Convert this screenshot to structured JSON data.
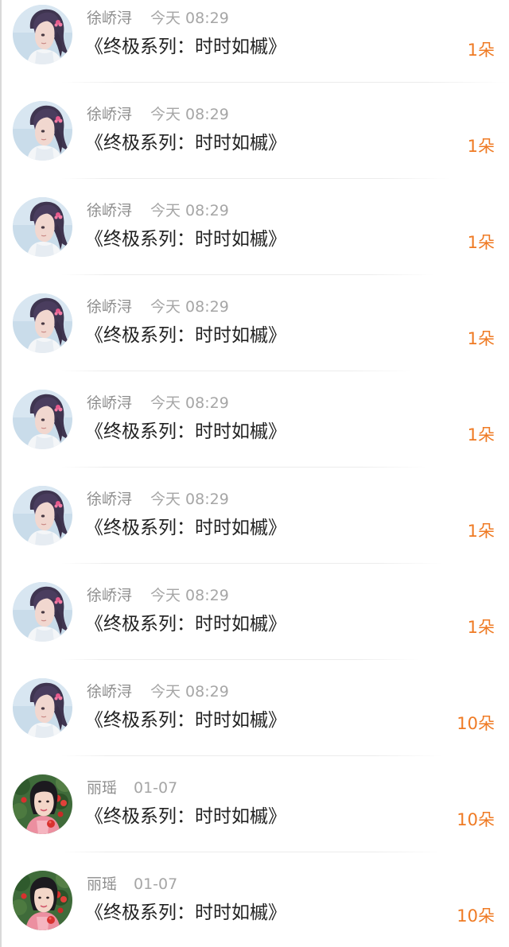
{
  "records": [
    {
      "name": "徐峤浔",
      "time": "今天 08:29",
      "title": "《终极系列：时时如槭》",
      "count": "1朵",
      "avatar": "girl-purple-hair-avatar"
    },
    {
      "name": "徐峤浔",
      "time": "今天 08:29",
      "title": "《终极系列：时时如槭》",
      "count": "1朵",
      "avatar": "girl-purple-hair-avatar"
    },
    {
      "name": "徐峤浔",
      "time": "今天 08:29",
      "title": "《终极系列：时时如槭》",
      "count": "1朵",
      "avatar": "girl-purple-hair-avatar"
    },
    {
      "name": "徐峤浔",
      "time": "今天 08:29",
      "title": "《终极系列：时时如槭》",
      "count": "1朵",
      "avatar": "girl-purple-hair-avatar"
    },
    {
      "name": "徐峤浔",
      "time": "今天 08:29",
      "title": "《终极系列：时时如槭》",
      "count": "1朵",
      "avatar": "girl-purple-hair-avatar"
    },
    {
      "name": "徐峤浔",
      "time": "今天 08:29",
      "title": "《终极系列：时时如槭》",
      "count": "1朵",
      "avatar": "girl-purple-hair-avatar"
    },
    {
      "name": "徐峤浔",
      "time": "今天 08:29",
      "title": "《终极系列：时时如槭》",
      "count": "1朵",
      "avatar": "girl-purple-hair-avatar"
    },
    {
      "name": "徐峤浔",
      "time": "今天 08:29",
      "title": "《终极系列：时时如槭》",
      "count": "10朵",
      "avatar": "girl-purple-hair-avatar"
    },
    {
      "name": "丽瑶",
      "time": "01-07",
      "title": "《终极系列：时时如槭》",
      "count": "10朵",
      "avatar": "girl-green-background-avatar"
    },
    {
      "name": "丽瑶",
      "time": "01-07",
      "title": "《终极系列：时时如槭》",
      "count": "10朵",
      "avatar": "girl-green-background-avatar"
    }
  ],
  "colors": {
    "accent": "#ef7a23",
    "name_text": "#8e8e8e",
    "time_text": "#a6a6a6",
    "title_text": "#222222"
  }
}
